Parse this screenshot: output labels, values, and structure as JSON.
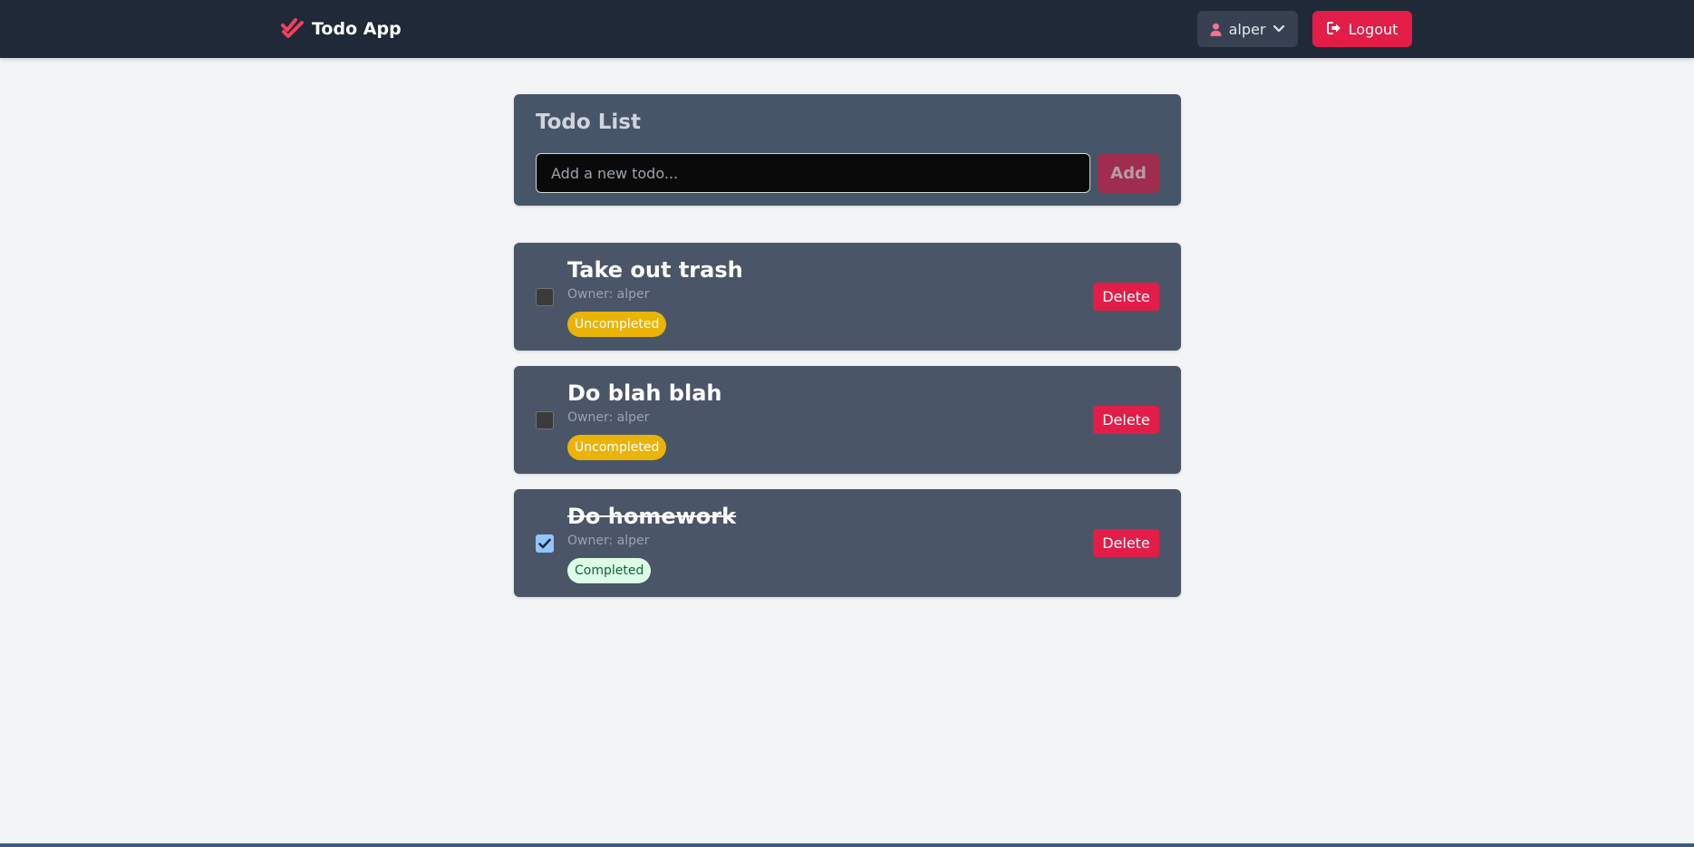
{
  "navbar": {
    "brand": "Todo App",
    "brand_icon": "double-check-icon",
    "brand_color": "#f43f5e",
    "user": {
      "name": "alper",
      "icon": "user-icon",
      "dropdown_icon": "chevron-down-icon"
    },
    "logout": {
      "label": "Logout",
      "icon": "sign-out-icon"
    }
  },
  "new_todo": {
    "title": "Todo List",
    "placeholder": "Add a new todo...",
    "value": "",
    "add_label": "Add"
  },
  "todos": [
    {
      "title": "Take out trash",
      "owner_prefix": "Owner:",
      "owner": "alper",
      "status": "Uncompleted",
      "completed": false,
      "delete_label": "Delete"
    },
    {
      "title": "Do blah blah",
      "owner_prefix": "Owner:",
      "owner": "alper",
      "status": "Uncompleted",
      "completed": false,
      "delete_label": "Delete"
    },
    {
      "title": "Do homework",
      "owner_prefix": "Owner:",
      "owner": "alper",
      "status": "Completed",
      "completed": true,
      "delete_label": "Delete"
    }
  ],
  "colors": {
    "navbar_bg": "#1f2937",
    "page_bg": "#f3f4f6",
    "card_bg": "#4b5568",
    "accent": "#e11d48",
    "uncompleted_badge": "#eab308",
    "completed_badge": "#dcfce7"
  }
}
